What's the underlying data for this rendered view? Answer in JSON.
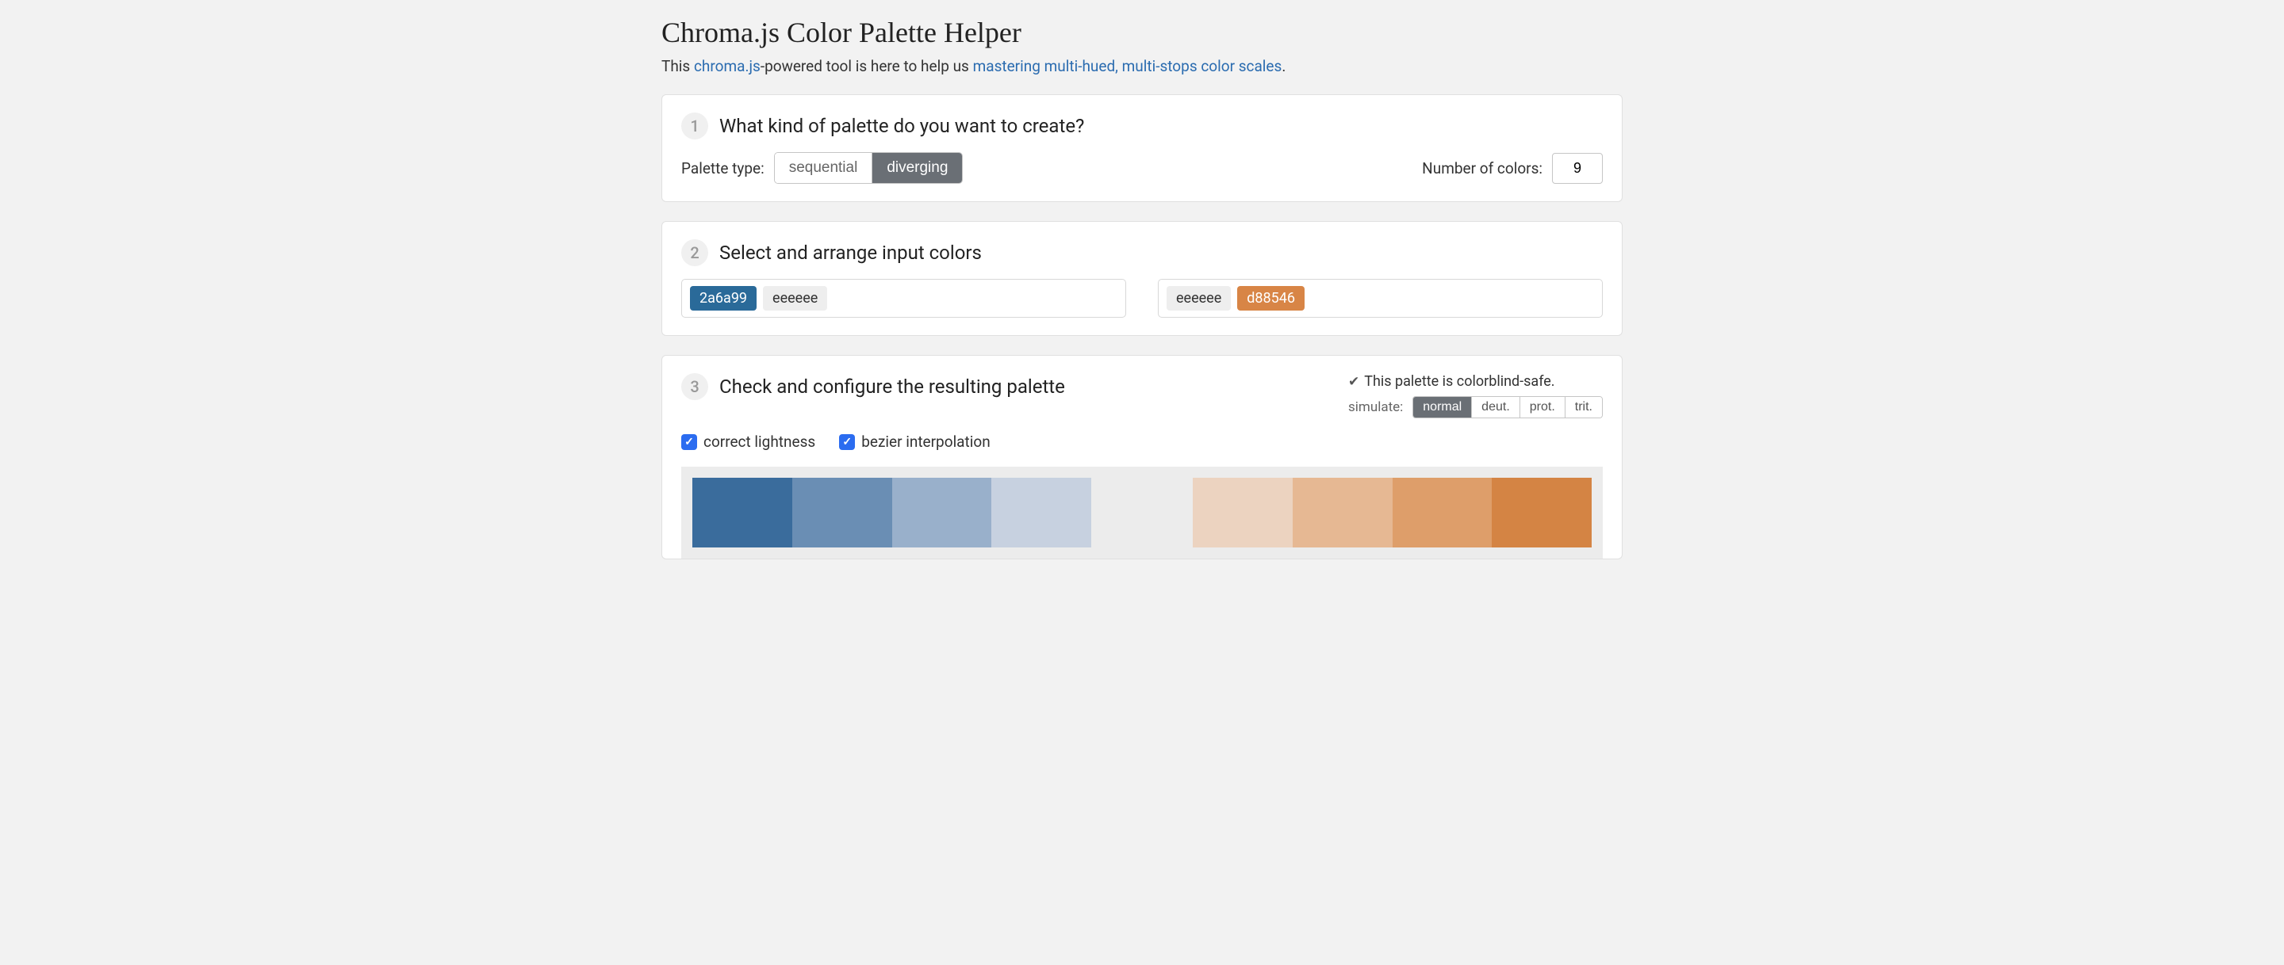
{
  "title": "Chroma.js Color Palette Helper",
  "subtitle_prefix": "This ",
  "link_chroma": "chroma.js",
  "subtitle_mid": "-powered tool is here to help us ",
  "link_article": "mastering multi-hued, multi-stops color scales",
  "subtitle_end": ".",
  "step1": {
    "num": "1",
    "title": "What kind of palette do you want to create?",
    "label_type": "Palette type:",
    "opt_sequential": "sequential",
    "opt_diverging": "diverging",
    "label_num": "Number of colors:",
    "num_value": "9"
  },
  "step2": {
    "num": "2",
    "title": "Select and arrange input colors",
    "left": [
      {
        "hex": "2a6a99",
        "bg": "#2a6a99",
        "fg": "#ffffff"
      },
      {
        "hex": "eeeeee",
        "bg": "#eeeeee",
        "fg": "#333333"
      }
    ],
    "right": [
      {
        "hex": "eeeeee",
        "bg": "#eeeeee",
        "fg": "#333333"
      },
      {
        "hex": "d88546",
        "bg": "#d88546",
        "fg": "#ffffff"
      }
    ]
  },
  "step3": {
    "num": "3",
    "title": "Check and configure the resulting palette",
    "cb_safe": "This palette is colorblind-safe.",
    "sim_label": "simulate:",
    "sim_opts": {
      "normal": "normal",
      "deut": "deut.",
      "prot": "prot.",
      "trit": "trit."
    },
    "chk_lightness": "correct lightness",
    "chk_bezier": "bezier interpolation",
    "palette_left": [
      "#3a6c9c",
      "#6a8eb4",
      "#99b0cb",
      "#c7d1e0"
    ],
    "palette_right": [
      "#ecd3c0",
      "#e6b893",
      "#de9e6a",
      "#d48444"
    ]
  }
}
